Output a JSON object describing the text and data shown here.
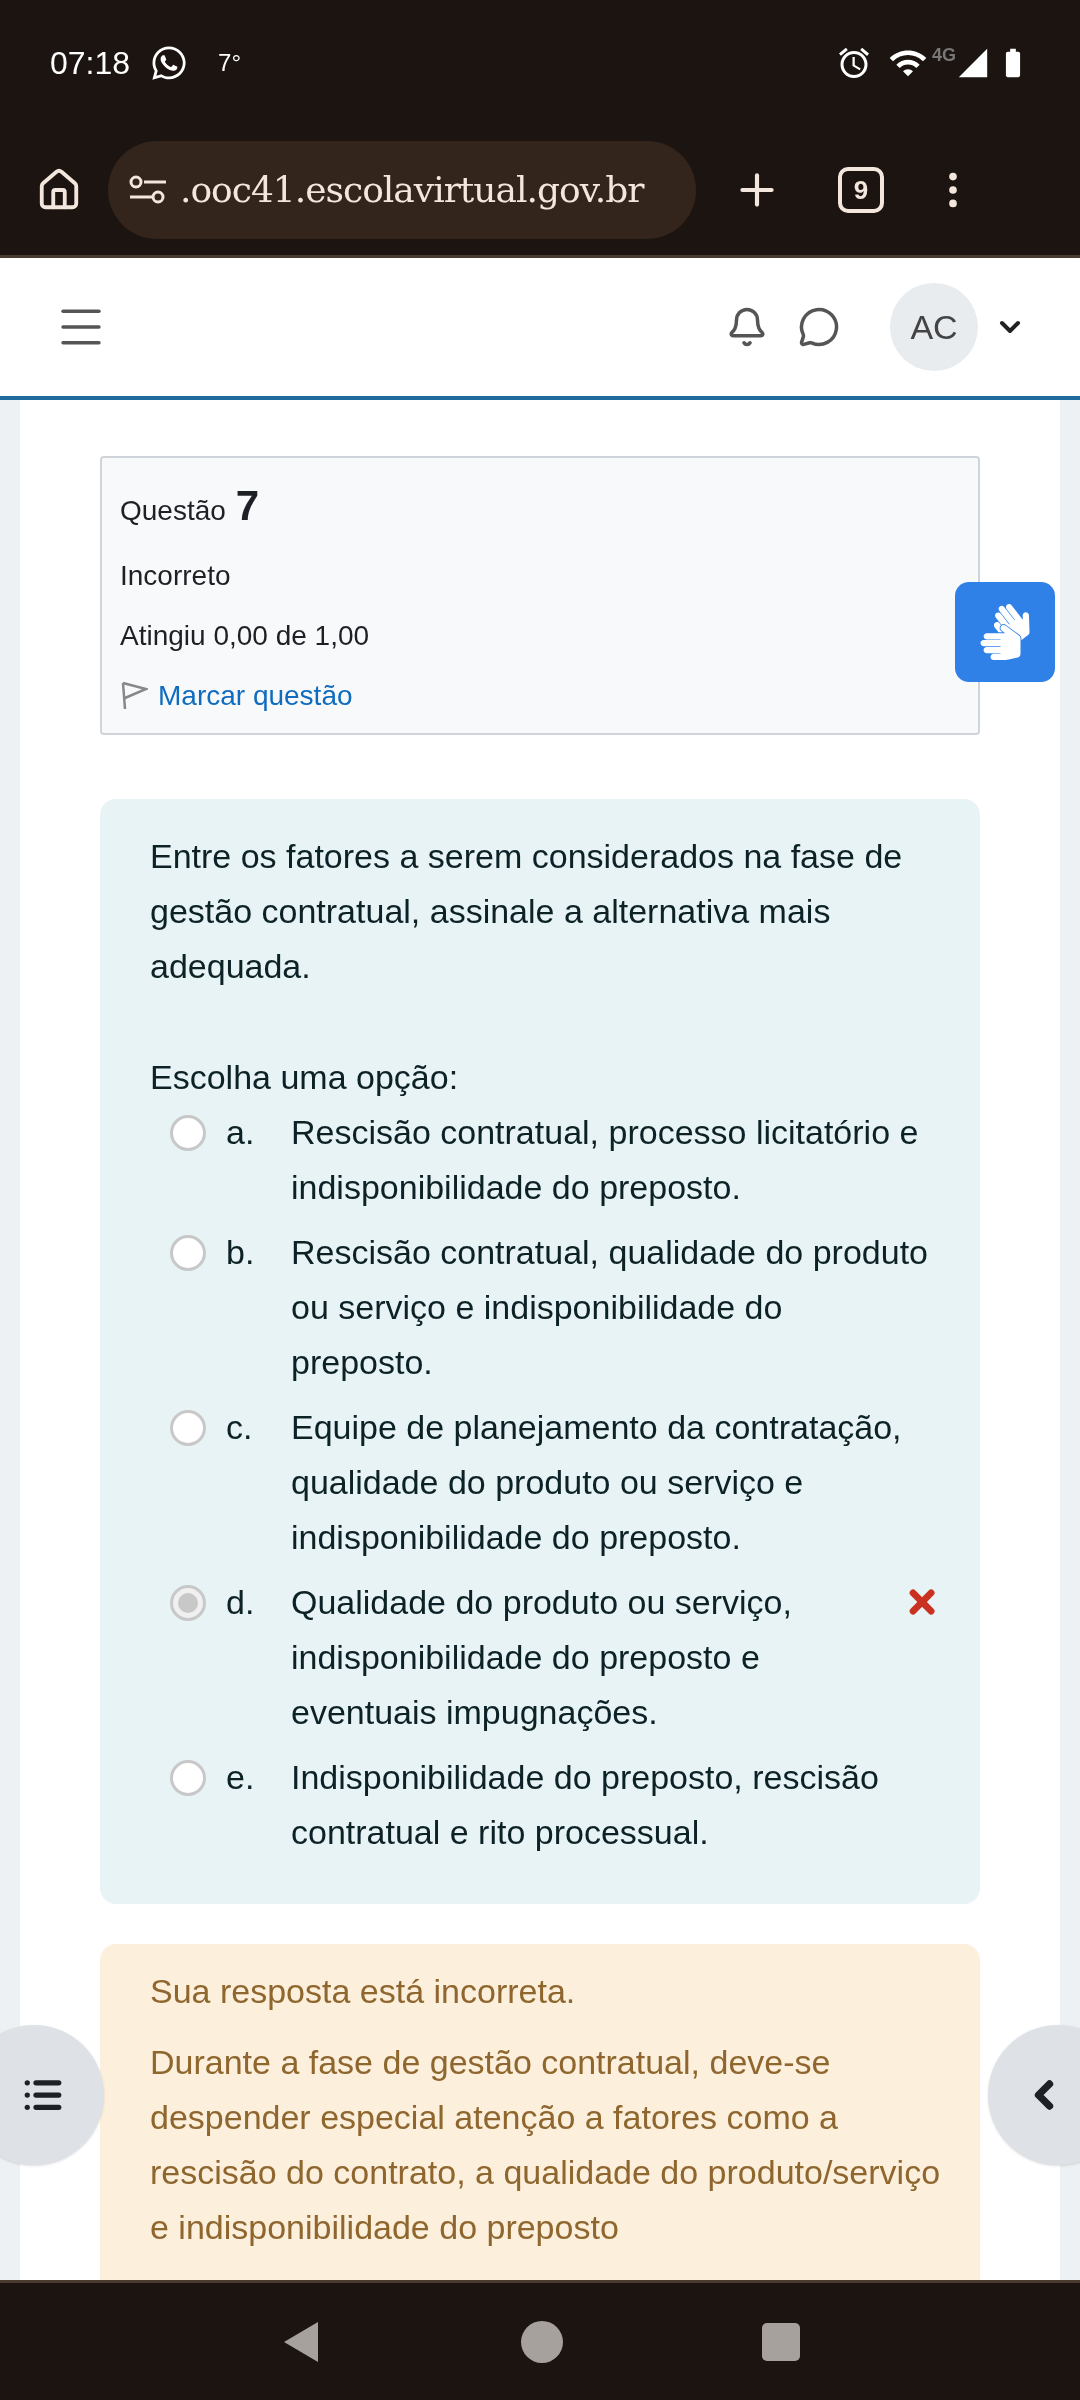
{
  "status_bar": {
    "time": "07:18",
    "temperature": "7°",
    "network": "4G"
  },
  "browser": {
    "url": ".ooc41.escolavirtual.gov.br",
    "tab_count": "9"
  },
  "header": {
    "avatar_initials": "AC"
  },
  "question_info": {
    "label": "Questão",
    "number": "7",
    "state": "Incorreto",
    "grade": "Atingiu 0,00 de 1,00",
    "flag_link": "Marcar questão"
  },
  "question": {
    "text": "Entre os fatores a serem considerados na fase de gestão contratual, assinale a alternativa mais adequada.",
    "prompt": "Escolha uma opção:",
    "options": [
      {
        "letter": "a.",
        "text": "Rescisão contratual, processo licitatório e indisponibilidade do preposto.",
        "selected": false,
        "marked_incorrect": false
      },
      {
        "letter": "b.",
        "text": "Rescisão contratual, qualidade do produto ou serviço e indisponibilidade do preposto.",
        "selected": false,
        "marked_incorrect": false
      },
      {
        "letter": "c.",
        "text": "Equipe de planejamento da contratação, qualidade do produto ou serviço e indisponibilidade do preposto.",
        "selected": false,
        "marked_incorrect": false
      },
      {
        "letter": "d.",
        "text": "Qualidade do produto ou serviço, indisponibilidade do preposto e eventuais impugnações.",
        "selected": true,
        "marked_incorrect": true
      },
      {
        "letter": "e.",
        "text": "Indisponibilidade do preposto, rescisão contratual e rito processual.",
        "selected": false,
        "marked_incorrect": false
      }
    ]
  },
  "feedback": {
    "title": "Sua resposta está incorreta.",
    "text": "Durante a fase de gestão contratual, deve-se despender especial atenção a fatores como a rescisão do contrato, a qualidade do produto/serviço e indisponibilidade do preposto"
  }
}
